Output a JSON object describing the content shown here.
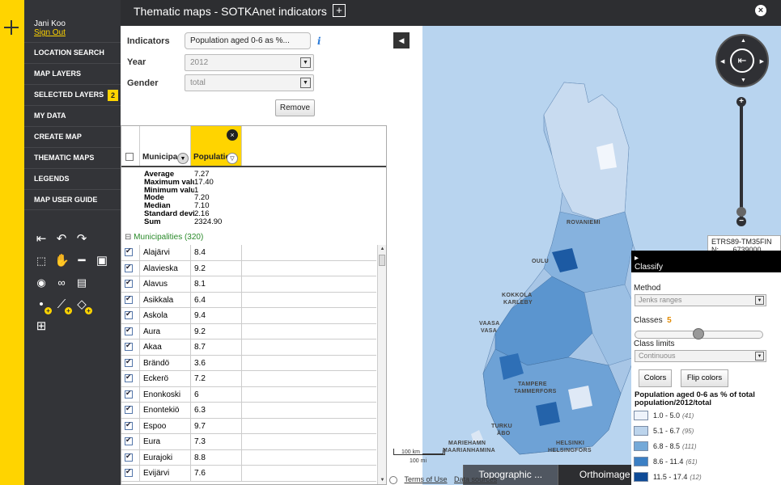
{
  "user": {
    "name": "Jani Koo",
    "signout": "Sign Out"
  },
  "nav": [
    {
      "label": "LOCATION SEARCH"
    },
    {
      "label": "MAP LAYERS"
    },
    {
      "label": "SELECTED LAYERS",
      "badge": "2"
    },
    {
      "label": "MY DATA"
    },
    {
      "label": "CREATE MAP"
    },
    {
      "label": "THEMATIC MAPS"
    },
    {
      "label": "LEGENDS"
    },
    {
      "label": "MAP USER GUIDE"
    }
  ],
  "header": {
    "title": "Thematic maps - SOTKAnet indicators",
    "add": "+",
    "close": "×"
  },
  "form": {
    "indicators_label": "Indicators",
    "indicators_value": "Population aged 0-6 as %...",
    "info": "i",
    "year_label": "Year",
    "year_value": "2012",
    "gender_label": "Gender",
    "gender_value": "total",
    "remove": "Remove",
    "collapse": "◀"
  },
  "grid": {
    "col1": "Municipality",
    "col2": "Population",
    "stats": [
      {
        "k": "Average",
        "v": "7.27"
      },
      {
        "k": "Maximum value",
        "v": "17.40"
      },
      {
        "k": "Minimum value",
        "v": "1"
      },
      {
        "k": "Mode",
        "v": "7.20"
      },
      {
        "k": "Median",
        "v": "7.10"
      },
      {
        "k": "Standard deviation",
        "v": "2.16"
      },
      {
        "k": "Sum",
        "v": "2324.90"
      }
    ],
    "group": "Municipalities (320)",
    "group_icon": "⊟",
    "rows": [
      {
        "name": "Alajärvi",
        "val": "8.4"
      },
      {
        "name": "Alavieska",
        "val": "9.2"
      },
      {
        "name": "Alavus",
        "val": "8.1"
      },
      {
        "name": "Asikkala",
        "val": "6.4"
      },
      {
        "name": "Askola",
        "val": "9.4"
      },
      {
        "name": "Aura",
        "val": "9.2"
      },
      {
        "name": "Akaa",
        "val": "8.7"
      },
      {
        "name": "Brändö",
        "val": "3.6"
      },
      {
        "name": "Eckerö",
        "val": "7.2"
      },
      {
        "name": "Enonkoski",
        "val": "6"
      },
      {
        "name": "Enontekiö",
        "val": "6.3"
      },
      {
        "name": "Espoo",
        "val": "9.7"
      },
      {
        "name": "Eura",
        "val": "7.3"
      },
      {
        "name": "Eurajoki",
        "val": "8.8"
      },
      {
        "name": "Evijärvi",
        "val": "7.6"
      }
    ]
  },
  "map": {
    "places": [
      "OULU",
      "KOKKOLA",
      "KARLEBY",
      "VAASA",
      "VASA",
      "TAMPERE",
      "TAMMERFORS",
      "TURKU",
      "ÅBO",
      "MARIEHAMN",
      "MAARIANHAMINA",
      "HELSINKI",
      "HELSINGFORS",
      "ROVANIEMI"
    ],
    "crs": "ETRS89-TM35FIN",
    "n_label": "N:",
    "n_value": "6739000",
    "scale_km": "100 km",
    "scale_mi": "100 mi",
    "base_layers": [
      "Topographic ...",
      "Orthoimage"
    ],
    "terms": "Terms of Use",
    "sources": "Data sources",
    "zoom_in": "+",
    "zoom_out": "−"
  },
  "classify": {
    "header": "Classify",
    "method_label": "Method",
    "method_value": "Jenks ranges",
    "classes_label": "Classes",
    "classes_value": "5",
    "limits_label": "Class limits",
    "limits_value": "Continuous",
    "colors_btn": "Colors",
    "flip_btn": "Flip colors",
    "legend_title": "Population aged 0-6 as % of total population/2012/total",
    "legend": [
      {
        "range": "1.0 - 5.0",
        "count": "(41)",
        "color": "#eef3fb"
      },
      {
        "range": "5.1 - 6.7",
        "count": "(95)",
        "color": "#bcd4ec"
      },
      {
        "range": "6.8 - 8.5",
        "count": "(111)",
        "color": "#74a9d8"
      },
      {
        "range": "8.6 - 11.4",
        "count": "(61)",
        "color": "#3b7fc4"
      },
      {
        "range": "11.5 - 17.4",
        "count": "(12)",
        "color": "#0e4a96"
      }
    ]
  }
}
